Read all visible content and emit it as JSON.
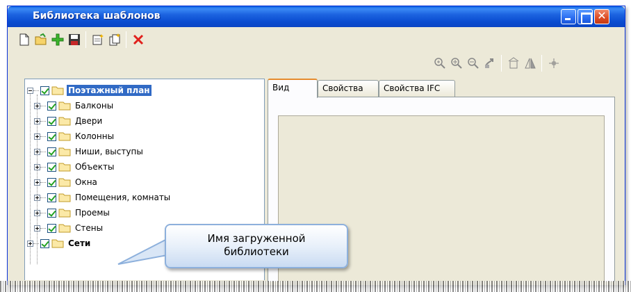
{
  "window": {
    "title": "Библиотека шаблонов"
  },
  "toolbar_left": [
    "new-icon",
    "open-icon",
    "add-icon",
    "save-icon",
    "new-template-icon",
    "copy-template-icon",
    "delete-icon"
  ],
  "toolbar_right": [
    "zoom-all-icon",
    "zoom-in-icon",
    "zoom-out-icon",
    "pan-icon",
    "rotate-view-icon",
    "mirror-icon",
    "snap-icon"
  ],
  "tree": {
    "root": {
      "label": "Поэтажный план",
      "checked": true,
      "expanded": true,
      "selected": true
    },
    "children": [
      {
        "label": "Балконы",
        "checked": true
      },
      {
        "label": "Двери",
        "checked": true
      },
      {
        "label": "Колонны",
        "checked": true
      },
      {
        "label": "Ниши, выступы",
        "checked": true
      },
      {
        "label": "Объекты",
        "checked": true
      },
      {
        "label": "Окна",
        "checked": true
      },
      {
        "label": "Помещения, комнаты",
        "checked": true
      },
      {
        "label": "Проемы",
        "checked": true
      },
      {
        "label": "Стены",
        "checked": true
      }
    ],
    "second_root": {
      "label": "Сети",
      "checked": true,
      "expanded": false
    }
  },
  "tabs": [
    {
      "label": "Вид",
      "active": true
    },
    {
      "label": "Свойства",
      "active": false
    },
    {
      "label": "Свойства IFC",
      "active": false
    }
  ],
  "callout": {
    "line1": "Имя загруженной",
    "line2": "библиотеки"
  },
  "colors": {
    "titlebar": "#0a4cd0",
    "selection": "#316ac5",
    "window_bg": "#ece9d8"
  }
}
